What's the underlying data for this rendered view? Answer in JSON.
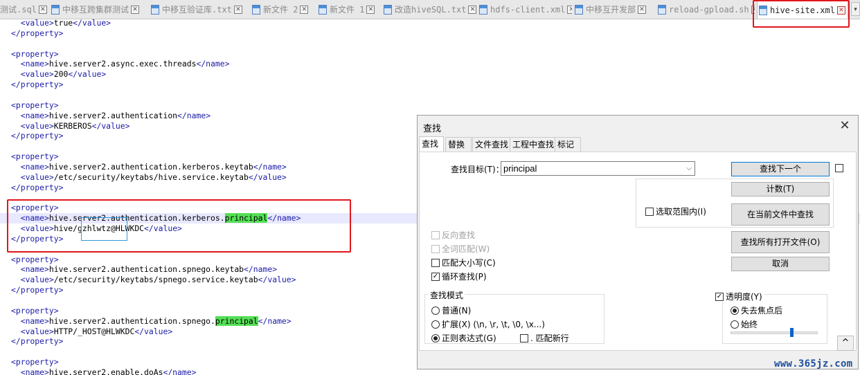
{
  "tabs": [
    {
      "label": "测试.sql",
      "close": "✕"
    },
    {
      "label": "中移互跨集群测试",
      "close": "✕"
    },
    {
      "label": "中移互验证库.txt",
      "close": "✕"
    },
    {
      "label": "新文件 2",
      "close": "✕"
    },
    {
      "label": "新文件 1",
      "close": "✕"
    },
    {
      "label": "改造hiveSQL.txt",
      "close": "✕"
    },
    {
      "label": "hdfs-client.xml",
      "close": "✕"
    },
    {
      "label": "中移互开发部",
      "close": "✕"
    },
    {
      "label": "reload-gpload.sh",
      "close": "✕"
    },
    {
      "label": "hive-site.xml",
      "close": "✕"
    }
  ],
  "tab_scroll_label": "▾",
  "editor_lines": [
    {
      "indent": "  ",
      "open": "<value>",
      "text": "true",
      "close": "</value>"
    },
    {
      "indent": "",
      "open": "</property>",
      "text": "",
      "close": ""
    },
    {
      "indent": "",
      "open": "",
      "text": "",
      "close": ""
    },
    {
      "indent": "",
      "open": "<property>",
      "text": "",
      "close": ""
    },
    {
      "indent": "  ",
      "open": "<name>",
      "text": "hive.server2.async.exec.threads",
      "close": "</name>"
    },
    {
      "indent": "  ",
      "open": "<value>",
      "text": "200",
      "close": "</value>"
    },
    {
      "indent": "",
      "open": "</property>",
      "text": "",
      "close": ""
    },
    {
      "indent": "",
      "open": "",
      "text": "",
      "close": ""
    },
    {
      "indent": "",
      "open": "<property>",
      "text": "",
      "close": ""
    },
    {
      "indent": "  ",
      "open": "<name>",
      "text": "hive.server2.authentication",
      "close": "</name>"
    },
    {
      "indent": "  ",
      "open": "<value>",
      "text": "KERBEROS",
      "close": "</value>"
    },
    {
      "indent": "",
      "open": "</property>",
      "text": "",
      "close": ""
    },
    {
      "indent": "",
      "open": "",
      "text": "",
      "close": ""
    },
    {
      "indent": "",
      "open": "<property>",
      "text": "",
      "close": ""
    },
    {
      "indent": "  ",
      "open": "<name>",
      "text": "hive.server2.authentication.kerberos.keytab",
      "close": "</name>"
    },
    {
      "indent": "  ",
      "open": "<value>",
      "text": "/etc/security/keytabs/hive.service.keytab",
      "close": "</value>"
    },
    {
      "indent": "",
      "open": "</property>",
      "text": "",
      "close": ""
    },
    {
      "indent": "",
      "open": "",
      "text": "",
      "close": ""
    },
    {
      "indent": "",
      "open": "<property>",
      "text": "",
      "close": ""
    },
    {
      "indent": "  ",
      "open": "<name>",
      "text": "hive.server2.authentication.kerberos.",
      "match": "principal",
      "close": "</name>",
      "highlight": true
    },
    {
      "indent": "  ",
      "open": "<value>",
      "text": "hive/gzhlwtz@HLWKDC",
      "close": "</value>"
    },
    {
      "indent": "",
      "open": "</property>",
      "text": "",
      "close": ""
    },
    {
      "indent": "",
      "open": "",
      "text": "",
      "close": ""
    },
    {
      "indent": "",
      "open": "<property>",
      "text": "",
      "close": ""
    },
    {
      "indent": "  ",
      "open": "<name>",
      "text": "hive.server2.authentication.spnego.keytab",
      "close": "</name>"
    },
    {
      "indent": "  ",
      "open": "<value>",
      "text": "/etc/security/keytabs/spnego.service.keytab",
      "close": "</value>"
    },
    {
      "indent": "",
      "open": "</property>",
      "text": "",
      "close": ""
    },
    {
      "indent": "",
      "open": "",
      "text": "",
      "close": ""
    },
    {
      "indent": "",
      "open": "<property>",
      "text": "",
      "close": ""
    },
    {
      "indent": "  ",
      "open": "<name>",
      "text": "hive.server2.authentication.spnego.",
      "match": "principal",
      "close": "</name>"
    },
    {
      "indent": "  ",
      "open": "<value>",
      "text": "HTTP/_HOST@HLWKDC",
      "close": "</value>"
    },
    {
      "indent": "",
      "open": "</property>",
      "text": "",
      "close": ""
    },
    {
      "indent": "",
      "open": "",
      "text": "",
      "close": ""
    },
    {
      "indent": "",
      "open": "<property>",
      "text": "",
      "close": ""
    },
    {
      "indent": "  ",
      "open": "<name>",
      "text": "hive.server2.enable.doAs",
      "close": "</name>"
    }
  ],
  "find_dialog": {
    "title": "查找",
    "close_glyph": "✕",
    "tabs": [
      "查找",
      "替换",
      "文件查找",
      "工程中查找",
      "标记"
    ],
    "target_label": "查找目标(T)：",
    "target_value": "principal",
    "dropdown_glyph": "⌵",
    "buttons": {
      "find_next": "查找下一个",
      "count": "计数(T)",
      "find_in_current": "在当前文件中查找",
      "find_all_open": "查找所有打开文件(O)",
      "cancel": "取消"
    },
    "in_selection_label": "选取范围内(I)",
    "options": {
      "reverse": "反向查找",
      "whole_word": "全词匹配(W)",
      "match_case": "匹配大小写(C)",
      "wrap": "循环查找(P)"
    },
    "search_mode": {
      "legend": "查找模式",
      "normal": "普通(N)",
      "extended": "扩展(X) (\\n, \\r, \\t, \\0, \\x...)",
      "regex": "正则表达式(G)",
      "dot_newline": ". 匹配新行"
    },
    "transparency": {
      "label": "透明度(Y)",
      "on_lose_focus": "失去焦点后",
      "always": "始终",
      "level": 0.7
    },
    "up_glyph": "^",
    "check_glyph": "✓"
  },
  "watermark": "www.365jz.com"
}
